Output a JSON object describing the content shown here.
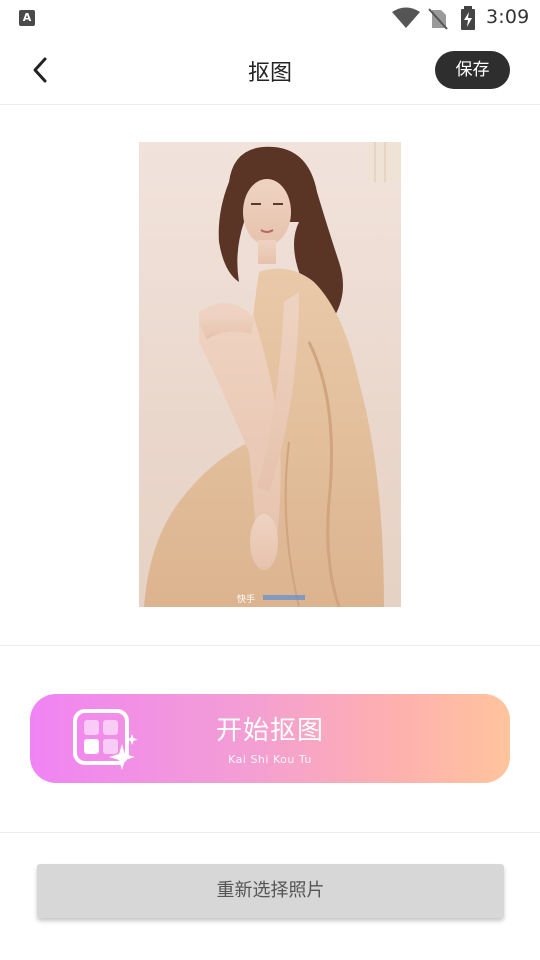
{
  "status_bar": {
    "app_icon_letter": "A",
    "time": "3:09",
    "icons": [
      "app-notification-icon",
      "wifi-icon",
      "no-sim-icon",
      "battery-charging-icon"
    ]
  },
  "header": {
    "back_icon": "chevron-left-icon",
    "title": "抠图",
    "save_label": "保存"
  },
  "photo": {
    "description_icon": "photo",
    "watermark": "快手"
  },
  "cta": {
    "icon": "grid-sparkle-icon",
    "title": "开始抠图",
    "subtitle": "Kai Shi Kou Tu",
    "gradient": [
      "#f084f4",
      "#ffc49c"
    ]
  },
  "reselect": {
    "label": "重新选择照片"
  },
  "colors": {
    "save_button_bg": "#2e2e2e",
    "reselect_bg": "#d7d7d7"
  }
}
